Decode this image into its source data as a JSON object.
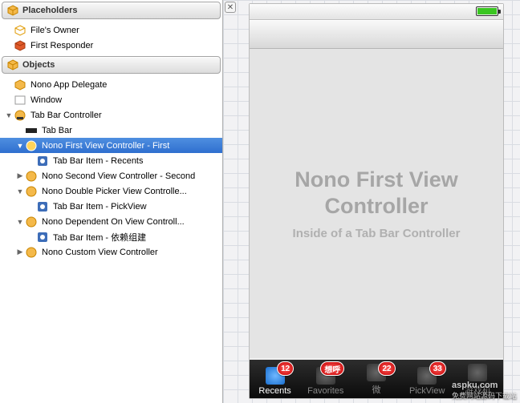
{
  "placeholders": {
    "title": "Placeholders",
    "items": [
      {
        "label": "File's Owner"
      },
      {
        "label": "First Responder"
      }
    ]
  },
  "objects": {
    "title": "Objects",
    "tree": {
      "app_delegate": "Nono App Delegate",
      "window": "Window",
      "tbc": "Tab Bar Controller",
      "tab_bar": "Tab Bar",
      "first_vc": "Nono First View Controller - First",
      "first_item": "Tab Bar Item - Recents",
      "second_vc": "Nono Second View Controller - Second",
      "double_vc": "Nono Double Picker View Controlle...",
      "pickview_item": "Tab Bar Item - PickView",
      "dependent_vc": "Nono Dependent On View Controll...",
      "dependent_item": "Tab Bar Item - 依赖组建",
      "custom_vc": "Nono Custom View Controller"
    }
  },
  "preview": {
    "title": "Nono First View Controller",
    "subtitle": "Inside of a Tab Bar Controller",
    "tabs": [
      {
        "label": "Recents",
        "badge": "12",
        "active": true
      },
      {
        "label": "Favorites",
        "badge": "想呼"
      },
      {
        "label": "微",
        "badge": "22"
      },
      {
        "label": "PickView",
        "badge": "33"
      },
      {
        "label": "游戏机",
        "badge": ""
      }
    ]
  },
  "watermark": {
    "main": "aspku.com",
    "sub": "免费网站源码下载站"
  }
}
